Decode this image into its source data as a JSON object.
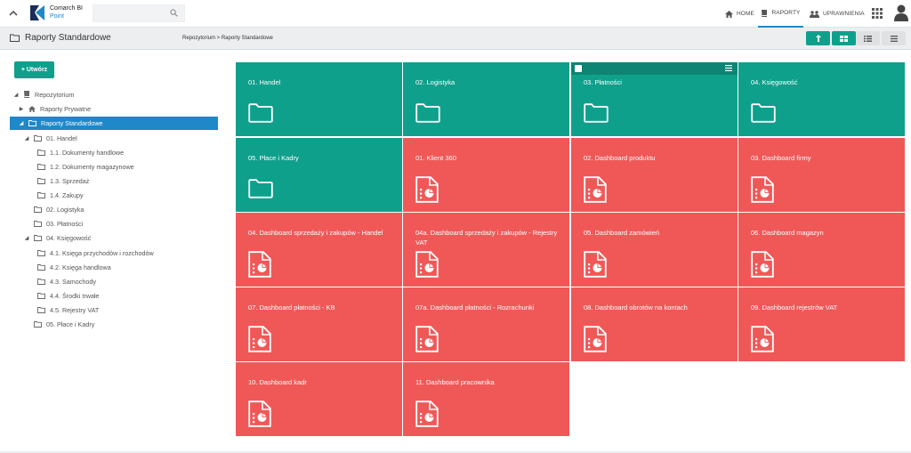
{
  "brand": {
    "line1": "Comarch BI",
    "line2": "Point"
  },
  "nav": {
    "home": "HOME",
    "reports": "RAPORTY",
    "permissions": "UPRAWNIENIA"
  },
  "page": {
    "title": "Raporty Standardowe",
    "breadcrumb": "Repozytorium > Raporty Standardowe"
  },
  "create_label": "+ Utwórz",
  "tree": [
    {
      "label": "Repozytorium",
      "arrow": "◢",
      "icon": "repository-icon"
    },
    {
      "label": "Raporty Prywatne",
      "arrow": "▶",
      "icon": "home-icon"
    },
    {
      "label": "Raporty Standardowe",
      "arrow": "◢",
      "icon": "folder-icon"
    },
    {
      "label": "01. Handel",
      "arrow": "◢",
      "icon": "folder-icon"
    },
    {
      "label": "1.1. Dokumenty handlowe",
      "arrow": "",
      "icon": "folder-icon"
    },
    {
      "label": "1.2. Dokumenty magazynowe",
      "arrow": "",
      "icon": "folder-icon"
    },
    {
      "label": "1.3. Sprzedaż",
      "arrow": "",
      "icon": "folder-icon"
    },
    {
      "label": "1.4. Zakupy",
      "arrow": "",
      "icon": "folder-icon"
    },
    {
      "label": "02. Logistyka",
      "arrow": "",
      "icon": "folder-icon"
    },
    {
      "label": "03. Płatności",
      "arrow": "",
      "icon": "folder-icon"
    },
    {
      "label": "04. Księgowość",
      "arrow": "◢",
      "icon": "folder-icon"
    },
    {
      "label": "4.1. Księga przychodów i rozchodów",
      "arrow": "",
      "icon": "folder-icon"
    },
    {
      "label": "4.2. Księga handlowa",
      "arrow": "",
      "icon": "folder-icon"
    },
    {
      "label": "4.3. Samochody",
      "arrow": "",
      "icon": "folder-icon"
    },
    {
      "label": "4.4. Środki trwałe",
      "arrow": "",
      "icon": "folder-icon"
    },
    {
      "label": "4.5. Rejestry VAT",
      "arrow": "",
      "icon": "folder-icon"
    },
    {
      "label": "05. Płace i Kadry",
      "arrow": "",
      "icon": "folder-icon"
    }
  ],
  "tiles": [
    {
      "label": "01. Handel",
      "kind": "folder"
    },
    {
      "label": "02. Logistyka",
      "kind": "folder"
    },
    {
      "label": "03. Płatności",
      "kind": "folder"
    },
    {
      "label": "04. Księgowość",
      "kind": "folder"
    },
    {
      "label": "05. Płace i Kadry",
      "kind": "folder"
    },
    {
      "label": "01. Klient 360",
      "kind": "dashboard"
    },
    {
      "label": "02. Dashboard produktu",
      "kind": "dashboard"
    },
    {
      "label": "03. Dashboard firmy",
      "kind": "dashboard"
    },
    {
      "label": "04. Dashboard sprzedaży i zakupów - Handel",
      "kind": "dashboard"
    },
    {
      "label": "04a. Dashboard sprzedaży i zakupów - Rejestry VAT",
      "kind": "dashboard"
    },
    {
      "label": "05. Dashboard zamówień",
      "kind": "dashboard"
    },
    {
      "label": "06. Dashboard magazyn",
      "kind": "dashboard"
    },
    {
      "label": "07. Dashboard płatności - KB",
      "kind": "dashboard"
    },
    {
      "label": "07a. Dashboard płatności - Rozrachunki",
      "kind": "dashboard"
    },
    {
      "label": "08. Dashboard obrotów na kontach",
      "kind": "dashboard"
    },
    {
      "label": "09. Dashboard rejestrów VAT",
      "kind": "dashboard"
    },
    {
      "label": "10. Dashboard kadr",
      "kind": "dashboard"
    },
    {
      "label": "11. Dashboard pracownika",
      "kind": "dashboard"
    }
  ],
  "colors": {
    "teal": "#0fa08c",
    "red": "#f05858",
    "blue": "#1e88c9"
  }
}
